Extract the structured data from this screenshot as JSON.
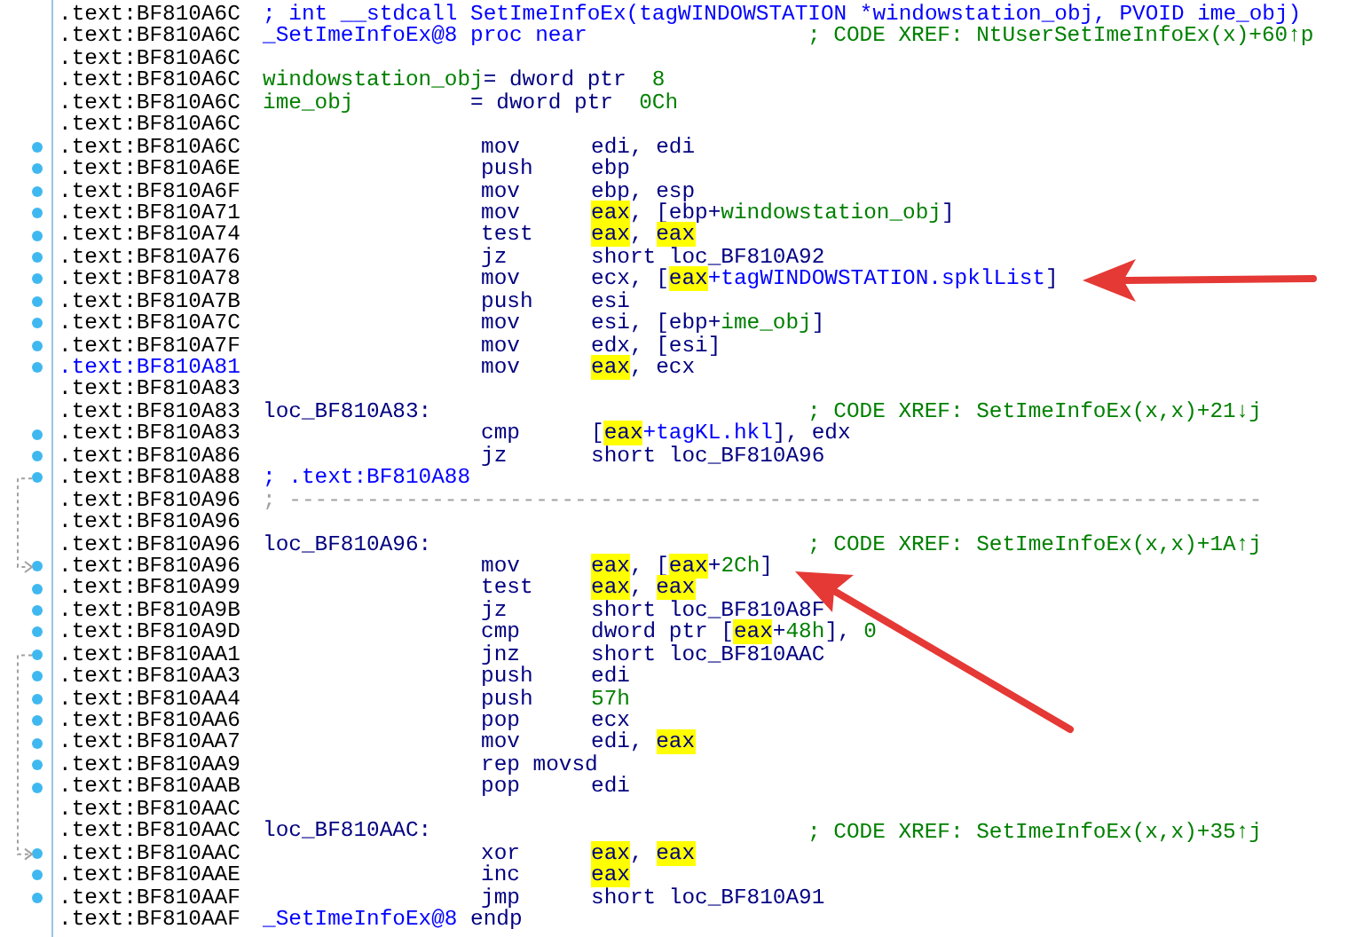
{
  "lines": [
    {
      "address": ".text:BF810A6C",
      "marker": false,
      "current": false,
      "label": [
        {
          "text": "; int __stdcall SetImeInfoEx(tagWINDOWSTATION *windowstation_obj, PVOID ime_obj)",
          "kind": "member"
        }
      ]
    },
    {
      "address": ".text:BF810A6C",
      "marker": false,
      "current": false,
      "label": [
        {
          "text": "_SetImeInfoEx@8 proc near",
          "kind": "member"
        }
      ],
      "comment": "; CODE XREF: NtUserSetImeInfoEx(x)+60↑p"
    },
    {
      "address": ".text:BF810A6C",
      "marker": false,
      "current": false
    },
    {
      "address": ".text:BF810A6C",
      "marker": false,
      "current": false,
      "label": [
        {
          "text": "windowstation_obj",
          "kind": "var"
        },
        {
          "text": "= dword ptr  ",
          "kind": "plain"
        },
        {
          "text": "8",
          "kind": "var"
        }
      ]
    },
    {
      "address": ".text:BF810A6C",
      "marker": false,
      "current": false,
      "label": [
        {
          "text": "ime_obj",
          "kind": "var"
        },
        {
          "text": "         = dword ptr  ",
          "kind": "plain"
        },
        {
          "text": "0Ch",
          "kind": "var"
        }
      ]
    },
    {
      "address": ".text:BF810A6C",
      "marker": false,
      "current": false
    },
    {
      "address": ".text:BF810A6C",
      "marker": true,
      "current": false,
      "mnemonic": "mov",
      "operands": [
        {
          "text": "edi, edi",
          "kind": "plain"
        }
      ]
    },
    {
      "address": ".text:BF810A6E",
      "marker": true,
      "current": false,
      "mnemonic": "push",
      "operands": [
        {
          "text": "ebp",
          "kind": "plain"
        }
      ]
    },
    {
      "address": ".text:BF810A6F",
      "marker": true,
      "current": false,
      "mnemonic": "mov",
      "operands": [
        {
          "text": "ebp, esp",
          "kind": "plain"
        }
      ]
    },
    {
      "address": ".text:BF810A71",
      "marker": true,
      "current": false,
      "mnemonic": "mov",
      "operands": [
        {
          "text": "eax",
          "kind": "highlight"
        },
        {
          "text": ", [ebp+",
          "kind": "plain"
        },
        {
          "text": "windowstation_obj",
          "kind": "var"
        },
        {
          "text": "]",
          "kind": "plain"
        }
      ]
    },
    {
      "address": ".text:BF810A74",
      "marker": true,
      "current": false,
      "mnemonic": "test",
      "operands": [
        {
          "text": "eax",
          "kind": "highlight"
        },
        {
          "text": ", ",
          "kind": "plain"
        },
        {
          "text": "eax",
          "kind": "highlight"
        }
      ]
    },
    {
      "address": ".text:BF810A76",
      "marker": true,
      "current": false,
      "mnemonic": "jz",
      "operands": [
        {
          "text": "short loc_BF810A92",
          "kind": "plain"
        }
      ]
    },
    {
      "address": ".text:BF810A78",
      "marker": true,
      "current": false,
      "mnemonic": "mov",
      "operands": [
        {
          "text": "ecx, [",
          "kind": "plain"
        },
        {
          "text": "eax",
          "kind": "highlight"
        },
        {
          "text": "+tagWINDOWSTATION.spklList",
          "kind": "member"
        },
        {
          "text": "]",
          "kind": "plain"
        }
      ]
    },
    {
      "address": ".text:BF810A7B",
      "marker": true,
      "current": false,
      "mnemonic": "push",
      "operands": [
        {
          "text": "esi",
          "kind": "plain"
        }
      ]
    },
    {
      "address": ".text:BF810A7C",
      "marker": true,
      "current": false,
      "mnemonic": "mov",
      "operands": [
        {
          "text": "esi, [ebp+",
          "kind": "plain"
        },
        {
          "text": "ime_obj",
          "kind": "var"
        },
        {
          "text": "]",
          "kind": "plain"
        }
      ]
    },
    {
      "address": ".text:BF810A7F",
      "marker": true,
      "current": false,
      "mnemonic": "mov",
      "operands": [
        {
          "text": "edx, [esi]",
          "kind": "plain"
        }
      ]
    },
    {
      "address": ".text:BF810A81",
      "marker": true,
      "current": true,
      "mnemonic": "mov",
      "operands": [
        {
          "text": "eax",
          "kind": "highlight"
        },
        {
          "text": ", ecx",
          "kind": "plain"
        }
      ]
    },
    {
      "address": ".text:BF810A83",
      "marker": false,
      "current": false
    },
    {
      "address": ".text:BF810A83",
      "marker": false,
      "current": false,
      "label": [
        {
          "text": "loc_BF810A83:",
          "kind": "plain"
        }
      ],
      "comment": "; CODE XREF: SetImeInfoEx(x,x)+21↓j"
    },
    {
      "address": ".text:BF810A83",
      "marker": true,
      "current": false,
      "mnemonic": "cmp",
      "operands": [
        {
          "text": "[",
          "kind": "plain"
        },
        {
          "text": "eax",
          "kind": "highlight"
        },
        {
          "text": "+tagKL.hkl",
          "kind": "member"
        },
        {
          "text": "], edx",
          "kind": "plain"
        }
      ]
    },
    {
      "address": ".text:BF810A86",
      "marker": true,
      "current": false,
      "mnemonic": "jz",
      "operands": [
        {
          "text": "short loc_BF810A96",
          "kind": "plain"
        }
      ]
    },
    {
      "address": ".text:BF810A88",
      "marker": true,
      "current": false,
      "label": [
        {
          "text": "; .text:BF810A88",
          "kind": "member"
        }
      ]
    },
    {
      "address": ".text:BF810A96",
      "marker": false,
      "current": false,
      "label": [
        {
          "text": "; ---------------------------------------------------------------------------",
          "kind": "rule"
        }
      ]
    },
    {
      "address": ".text:BF810A96",
      "marker": false,
      "current": false
    },
    {
      "address": ".text:BF810A96",
      "marker": false,
      "current": false,
      "label": [
        {
          "text": "loc_BF810A96:",
          "kind": "plain"
        }
      ],
      "comment": "; CODE XREF: SetImeInfoEx(x,x)+1A↑j"
    },
    {
      "address": ".text:BF810A96",
      "marker": true,
      "current": false,
      "mnemonic": "mov",
      "operands": [
        {
          "text": "eax",
          "kind": "highlight"
        },
        {
          "text": ", [",
          "kind": "plain"
        },
        {
          "text": "eax",
          "kind": "highlight"
        },
        {
          "text": "+",
          "kind": "plain"
        },
        {
          "text": "2Ch",
          "kind": "var"
        },
        {
          "text": "]",
          "kind": "plain"
        }
      ]
    },
    {
      "address": ".text:BF810A99",
      "marker": true,
      "current": false,
      "mnemonic": "test",
      "operands": [
        {
          "text": "eax",
          "kind": "highlight"
        },
        {
          "text": ", ",
          "kind": "plain"
        },
        {
          "text": "eax",
          "kind": "highlight"
        }
      ]
    },
    {
      "address": ".text:BF810A9B",
      "marker": true,
      "current": false,
      "mnemonic": "jz",
      "operands": [
        {
          "text": "short loc_BF810A8F",
          "kind": "plain"
        }
      ]
    },
    {
      "address": ".text:BF810A9D",
      "marker": true,
      "current": false,
      "mnemonic": "cmp",
      "operands": [
        {
          "text": "dword ptr [",
          "kind": "plain"
        },
        {
          "text": "eax",
          "kind": "highlight"
        },
        {
          "text": "+",
          "kind": "plain"
        },
        {
          "text": "48h",
          "kind": "var"
        },
        {
          "text": "], ",
          "kind": "plain"
        },
        {
          "text": "0",
          "kind": "var"
        }
      ]
    },
    {
      "address": ".text:BF810AA1",
      "marker": true,
      "current": false,
      "mnemonic": "jnz",
      "operands": [
        {
          "text": "short loc_BF810AAC",
          "kind": "plain"
        }
      ]
    },
    {
      "address": ".text:BF810AA3",
      "marker": true,
      "current": false,
      "mnemonic": "push",
      "operands": [
        {
          "text": "edi",
          "kind": "plain"
        }
      ]
    },
    {
      "address": ".text:BF810AA4",
      "marker": true,
      "current": false,
      "mnemonic": "push",
      "operands": [
        {
          "text": "57h",
          "kind": "var"
        }
      ]
    },
    {
      "address": ".text:BF810AA6",
      "marker": true,
      "current": false,
      "mnemonic": "pop",
      "operands": [
        {
          "text": "ecx",
          "kind": "plain"
        }
      ]
    },
    {
      "address": ".text:BF810AA7",
      "marker": true,
      "current": false,
      "mnemonic": "mov",
      "operands": [
        {
          "text": "edi, ",
          "kind": "plain"
        },
        {
          "text": "eax",
          "kind": "highlight"
        }
      ]
    },
    {
      "address": ".text:BF810AA9",
      "marker": true,
      "current": false,
      "mnemonic": "rep movsd"
    },
    {
      "address": ".text:BF810AAB",
      "marker": true,
      "current": false,
      "mnemonic": "pop",
      "operands": [
        {
          "text": "edi",
          "kind": "plain"
        }
      ]
    },
    {
      "address": ".text:BF810AAC",
      "marker": false,
      "current": false
    },
    {
      "address": ".text:BF810AAC",
      "marker": false,
      "current": false,
      "label": [
        {
          "text": "loc_BF810AAC:",
          "kind": "plain"
        }
      ],
      "comment": "; CODE XREF: SetImeInfoEx(x,x)+35↑j"
    },
    {
      "address": ".text:BF810AAC",
      "marker": true,
      "current": false,
      "mnemonic": "xor",
      "operands": [
        {
          "text": "eax",
          "kind": "highlight"
        },
        {
          "text": ", ",
          "kind": "plain"
        },
        {
          "text": "eax",
          "kind": "highlight"
        }
      ]
    },
    {
      "address": ".text:BF810AAE",
      "marker": true,
      "current": false,
      "mnemonic": "inc",
      "operands": [
        {
          "text": "eax",
          "kind": "highlight"
        }
      ]
    },
    {
      "address": ".text:BF810AAF",
      "marker": true,
      "current": false,
      "mnemonic": "jmp",
      "operands": [
        {
          "text": "short loc_BF810A91",
          "kind": "plain"
        }
      ]
    },
    {
      "address": ".text:BF810AAF",
      "marker": false,
      "current": false,
      "label": [
        {
          "text": "_SetImeInfoEx@8 ",
          "kind": "member"
        },
        {
          "text": "endp",
          "kind": "plain"
        }
      ]
    }
  ]
}
